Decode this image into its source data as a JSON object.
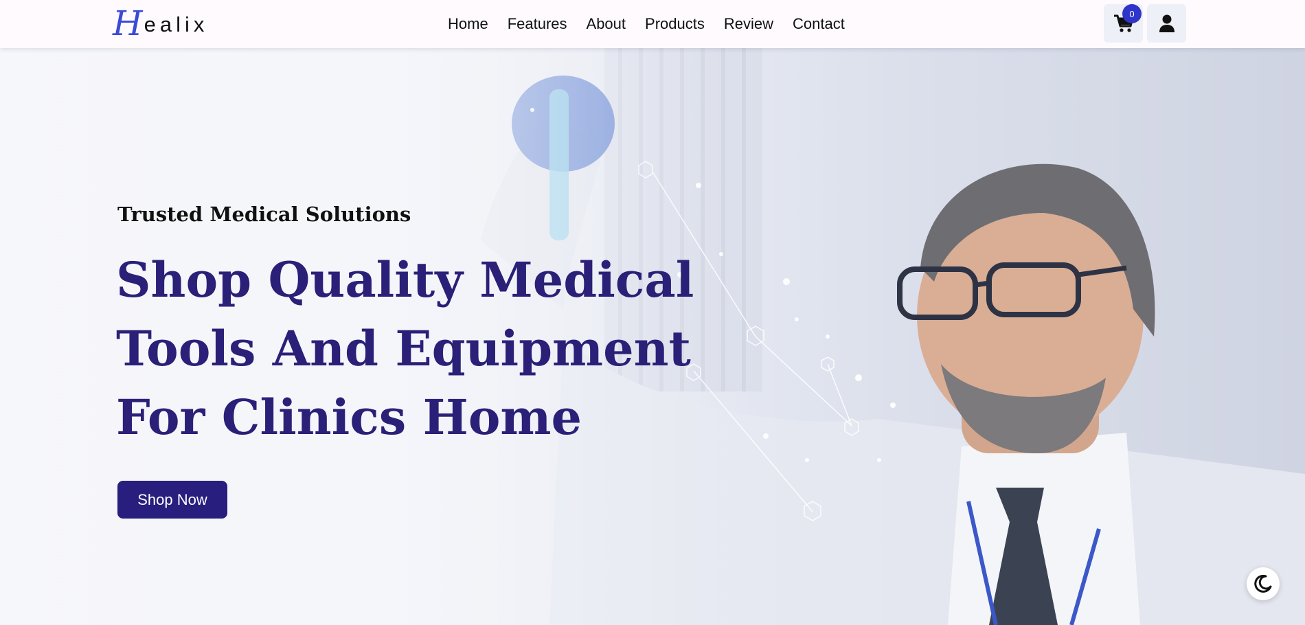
{
  "brand": {
    "logo_initial": "H",
    "logo_rest": "ealix",
    "accent": "#3a4bd6"
  },
  "nav": {
    "items": [
      {
        "label": "Home"
      },
      {
        "label": "Features"
      },
      {
        "label": "About"
      },
      {
        "label": "Products"
      },
      {
        "label": "Review"
      },
      {
        "label": "Contact"
      }
    ]
  },
  "header_actions": {
    "cart_count": "0",
    "cart_icon": "cart-icon",
    "user_icon": "user-icon"
  },
  "hero": {
    "subtitle": "Trusted Medical Solutions",
    "headline_line1": "Shop Quality Medical",
    "headline_line2": "Tools And Equipment",
    "headline_line3": "For Clinics Home",
    "cta_label": "Shop Now",
    "headline_color": "#2a2078",
    "cta_color": "#281e7d"
  },
  "theme_toggle": {
    "icon": "moon-icon"
  }
}
